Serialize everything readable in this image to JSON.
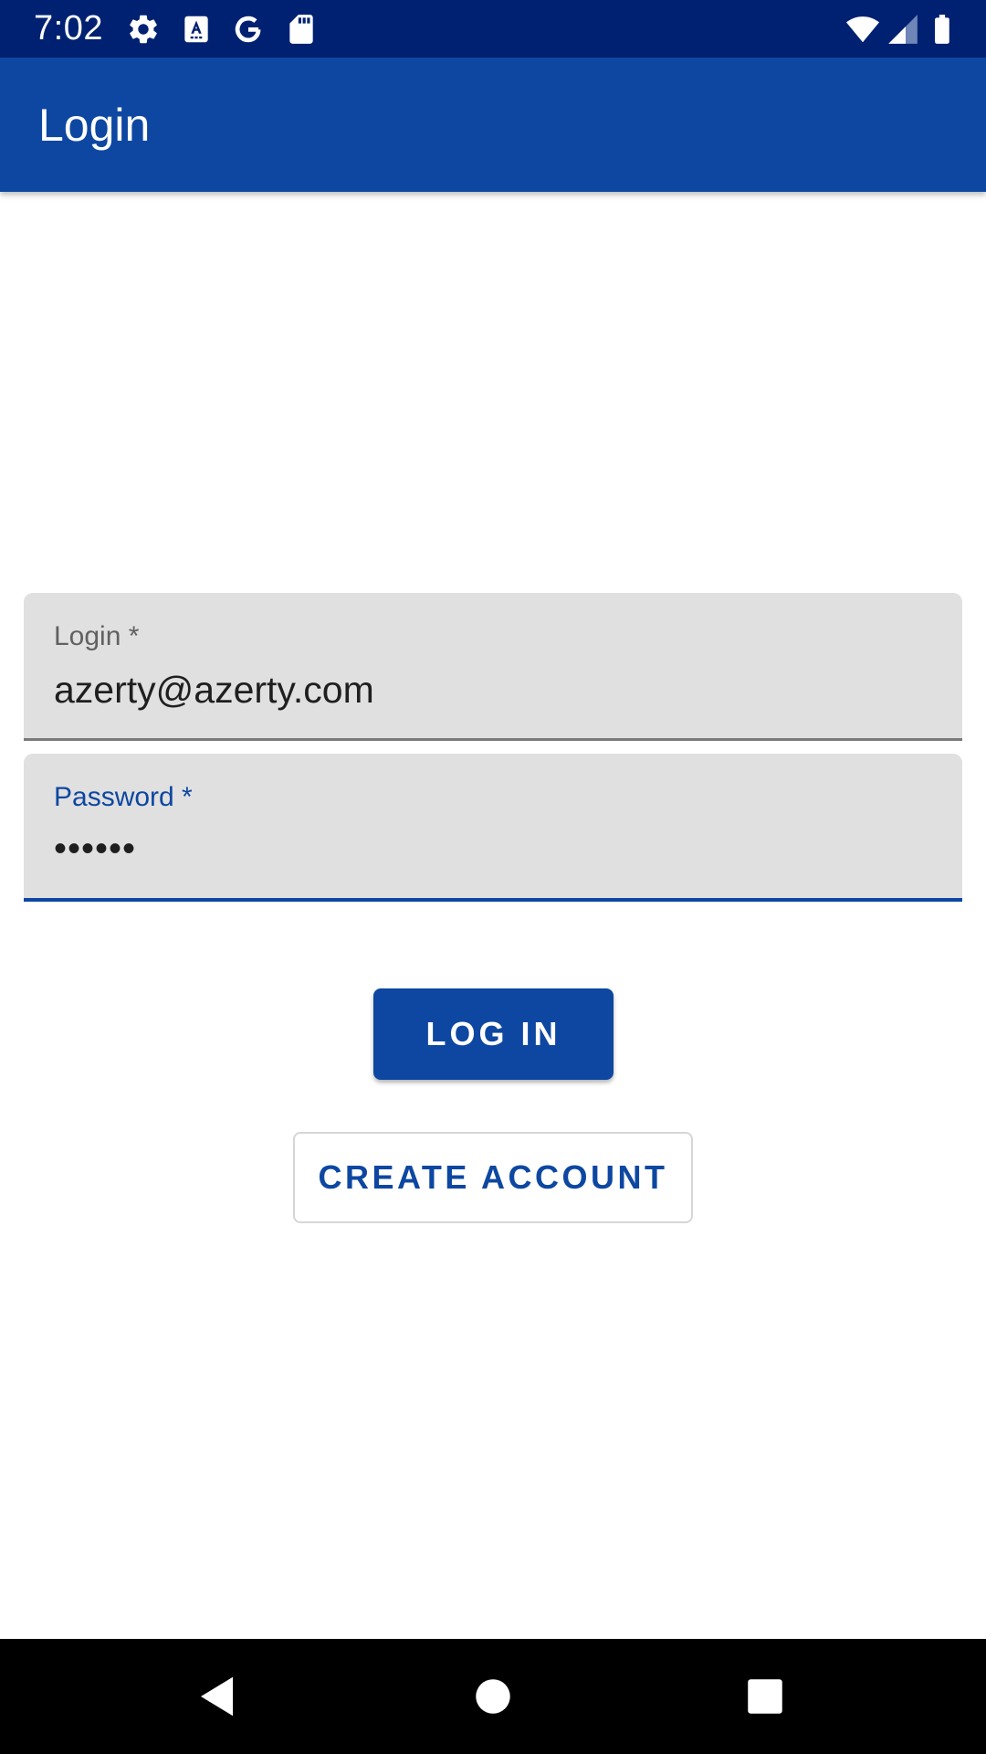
{
  "status_bar": {
    "time": "7:02",
    "icons_left": [
      "gear-icon",
      "text-a-icon",
      "google-g-icon",
      "sd-card-icon"
    ],
    "icons_right": [
      "wifi-icon",
      "signal-icon",
      "battery-icon"
    ]
  },
  "app_bar": {
    "title": "Login"
  },
  "form": {
    "login": {
      "label": "Login *",
      "value": "azerty@azerty.com"
    },
    "password": {
      "label": "Password *",
      "value": "••••••"
    }
  },
  "buttons": {
    "login": "LOG IN",
    "create_account": "CREATE ACCOUNT"
  },
  "nav_bar": {
    "buttons": [
      "back-icon",
      "home-icon",
      "recents-icon"
    ]
  },
  "colors": {
    "status_bar": "#002171",
    "primary": "#0d47a1",
    "field_bg": "#e0e0e0"
  }
}
